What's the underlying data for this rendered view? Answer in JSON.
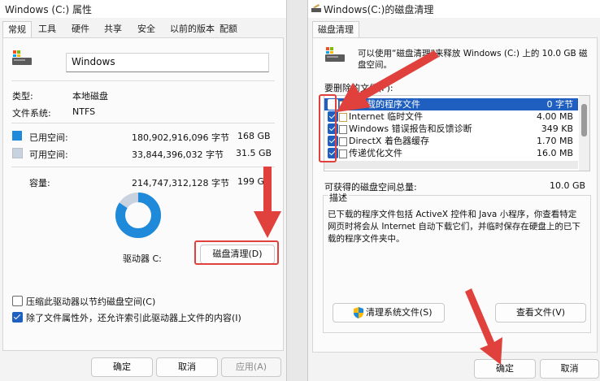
{
  "colors": {
    "used": "#1f8ad9",
    "free": "#c8d3df",
    "accent": "#1f5fbf",
    "annotation": "#e0413c"
  },
  "props": {
    "title": "Windows (C:) 属性",
    "tabs": [
      "常规",
      "工具",
      "硬件",
      "共享",
      "安全",
      "以前的版本",
      "配额"
    ],
    "drive_name": "Windows",
    "type_label": "类型:",
    "type_value": "本地磁盘",
    "fs_label": "文件系统:",
    "fs_value": "NTFS",
    "used": {
      "label": "已用空间:",
      "bytes": "180,902,916,096 字节",
      "size": "168 GB"
    },
    "free": {
      "label": "可用空间:",
      "bytes": "33,844,396,032 字节",
      "size": "31.5 GB"
    },
    "capacity": {
      "label": "容量:",
      "bytes": "214,747,312,128 字节",
      "size": "199 GB"
    },
    "used_fraction": 0.8424,
    "drive_letter": "驱动器 C:",
    "cleanup_button": "磁盘清理(D)",
    "compress_label": "压缩此驱动器以节约磁盘空间(C)",
    "compress_checked": false,
    "index_label": "除了文件属性外，还允许索引此驱动器上文件的内容(I)",
    "index_checked": true,
    "ok": "确定",
    "cancel": "取消",
    "apply": "应用(A)"
  },
  "cleanup": {
    "title": "Windows(C:)的磁盘清理",
    "tab": "磁盘清理",
    "intro": "可以使用“磁盘清理”来释放 Windows (C:) 上的 10.0 GB 磁盘空间。",
    "files_label": "要删除的文件(F):",
    "files": [
      {
        "name": "已下载的程序文件",
        "size": "0 字节",
        "checked": true,
        "selected": true
      },
      {
        "name": "Internet 临时文件",
        "size": "4.00 MB",
        "checked": true,
        "selected": false
      },
      {
        "name": "Windows 错误报告和反馈诊断",
        "size": "349 KB",
        "checked": true,
        "selected": false
      },
      {
        "name": "DirectX 着色器缓存",
        "size": "1.70 MB",
        "checked": true,
        "selected": false
      },
      {
        "name": "传递优化文件",
        "size": "16.0 MB",
        "checked": true,
        "selected": false
      }
    ],
    "total_label": "可获得的磁盘空间总量:",
    "total_value": "10.0 GB",
    "desc_label": "描述",
    "desc_text": "已下载的程序文件包括 ActiveX 控件和 Java 小程序，你查看特定网页时将会从 Internet 自动下载它们，并临时保存在硬盘上的已下载的程序文件夹中。",
    "clean_system_button": "清理系统文件(S)",
    "view_files_button": "查看文件(V)",
    "ok": "确定",
    "cancel": "取消"
  }
}
